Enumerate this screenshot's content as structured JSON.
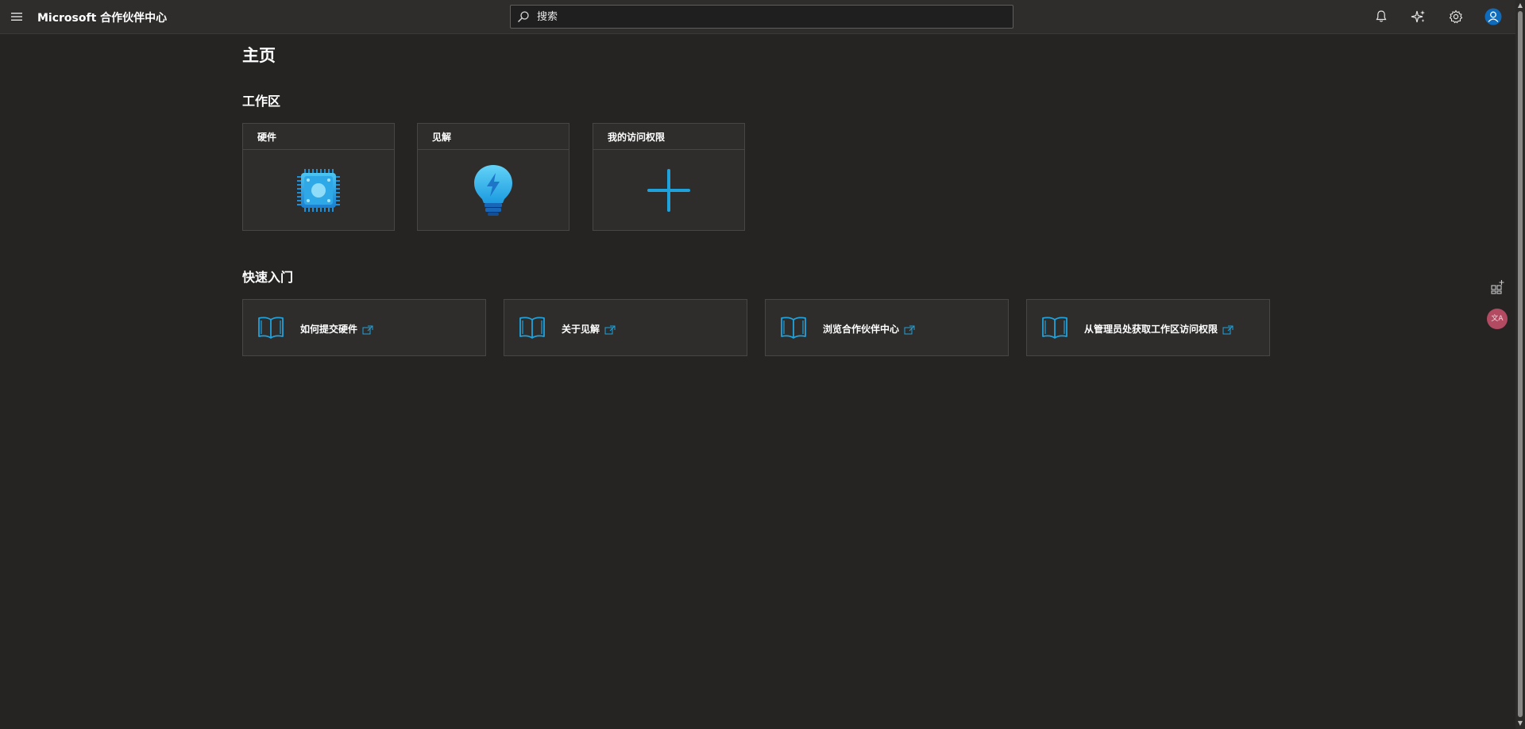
{
  "header": {
    "brand": "Microsoft 合作伙伴中心",
    "search_placeholder": "搜索",
    "icons": [
      "hamburger-icon",
      "search-icon",
      "bell-icon",
      "copilot-sparkle-icon",
      "gear-icon",
      "avatar-icon"
    ]
  },
  "main": {
    "page_title": "主页",
    "workspaces_title": "工作区",
    "tiles": [
      {
        "label": "硬件",
        "icon": "chip-icon"
      },
      {
        "label": "见解",
        "icon": "lightbulb-icon"
      },
      {
        "label": "我的访问权限",
        "icon": "plus-icon"
      }
    ],
    "quickstart_title": "快速入门",
    "quick_links": [
      {
        "label": "如何提交硬件",
        "icon": "book-icon"
      },
      {
        "label": "关于见解",
        "icon": "book-icon"
      },
      {
        "label": "浏览合作伙伴中心",
        "icon": "book-icon"
      },
      {
        "label": "从管理员处获取工作区访问权限",
        "icon": "book-icon"
      }
    ]
  },
  "side": {
    "translate_label": "文A"
  },
  "colors": {
    "background": "#252423",
    "header": "#2e2d2c",
    "accent": "#1fa2dc",
    "avatar": "#0f6cbd"
  }
}
